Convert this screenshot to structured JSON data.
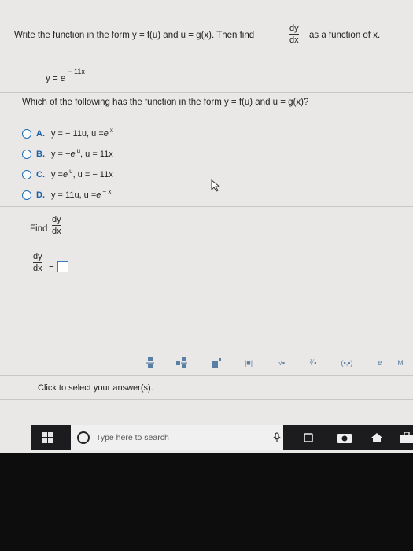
{
  "question": {
    "intro": "Write the function in the form y = f(u) and u = g(x). Then find",
    "frac_num": "dy",
    "frac_den": "dx",
    "intro_end": "as a function of x.",
    "func_prefix": "y = ",
    "func_base": "e",
    "func_exp": "− 11x",
    "which": "Which of the following has the function in the form y = f(u) and u = g(x)?"
  },
  "options": [
    {
      "label": "A.",
      "text": "y = − 11u, u = ",
      "expr": "e",
      "sup": "x",
      "tail": ""
    },
    {
      "label": "B.",
      "text": "y = − ",
      "expr": "e",
      "sup": "u",
      "tail": ", u = 11x"
    },
    {
      "label": "C.",
      "text": "y = ",
      "expr": "e",
      "sup": "u",
      "tail": ", u = − 11x"
    },
    {
      "label": "D.",
      "text": "y = 11u, u = ",
      "expr": "e",
      "sup": "− x",
      "tail": ""
    }
  ],
  "find": {
    "label": "Find",
    "num": "dy",
    "den": "dx"
  },
  "answer": {
    "num": "dy",
    "den": "dx",
    "equals": "="
  },
  "toolbar": {
    "buttons": [
      "frac",
      "mixed",
      "exp",
      "|■|",
      "√▪",
      "∛▪",
      "(▪,▪)",
      "e",
      "M"
    ]
  },
  "footer": {
    "instruction": "Click to select your answer(s)."
  },
  "taskbar": {
    "search_placeholder": "Type here to search"
  },
  "colors": {
    "accent": "#1d6bb5",
    "taskbar": "#1c1c1e"
  }
}
